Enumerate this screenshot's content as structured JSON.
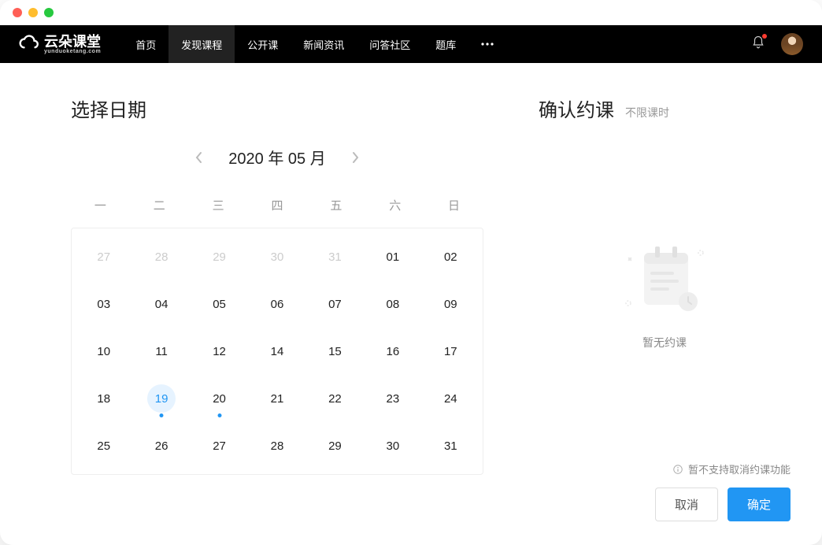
{
  "brand": {
    "name": "云朵课堂",
    "domain": "yunduoketang.com"
  },
  "nav": {
    "items": [
      {
        "label": "首页",
        "active": false
      },
      {
        "label": "发现课程",
        "active": true
      },
      {
        "label": "公开课",
        "active": false
      },
      {
        "label": "新闻资讯",
        "active": false
      },
      {
        "label": "问答社区",
        "active": false
      },
      {
        "label": "题库",
        "active": false
      }
    ],
    "has_more": true,
    "has_notification": true
  },
  "left": {
    "title": "选择日期",
    "calendar": {
      "year": 2020,
      "month": 5,
      "title": "2020 年 05 月",
      "weekdays": [
        "一",
        "二",
        "三",
        "四",
        "五",
        "六",
        "日"
      ],
      "cells": [
        {
          "d": "27",
          "muted": true
        },
        {
          "d": "28",
          "muted": true
        },
        {
          "d": "29",
          "muted": true
        },
        {
          "d": "30",
          "muted": true
        },
        {
          "d": "31",
          "muted": true
        },
        {
          "d": "01"
        },
        {
          "d": "02"
        },
        {
          "d": "03"
        },
        {
          "d": "04"
        },
        {
          "d": "05"
        },
        {
          "d": "06"
        },
        {
          "d": "07"
        },
        {
          "d": "08"
        },
        {
          "d": "09"
        },
        {
          "d": "10"
        },
        {
          "d": "11"
        },
        {
          "d": "12"
        },
        {
          "d": "14"
        },
        {
          "d": "15"
        },
        {
          "d": "16"
        },
        {
          "d": "17"
        },
        {
          "d": "18"
        },
        {
          "d": "19",
          "today": true,
          "dot": true
        },
        {
          "d": "20",
          "dot": true
        },
        {
          "d": "21"
        },
        {
          "d": "22"
        },
        {
          "d": "23"
        },
        {
          "d": "24"
        },
        {
          "d": "25"
        },
        {
          "d": "26"
        },
        {
          "d": "27"
        },
        {
          "d": "28"
        },
        {
          "d": "29"
        },
        {
          "d": "30"
        },
        {
          "d": "31"
        }
      ]
    }
  },
  "right": {
    "title": "确认约课",
    "subtitle": "不限课时",
    "empty_text": "暂无约课",
    "notice": "暂不支持取消约课功能",
    "cancel_label": "取消",
    "confirm_label": "确定"
  },
  "colors": {
    "primary": "#2196f3"
  }
}
